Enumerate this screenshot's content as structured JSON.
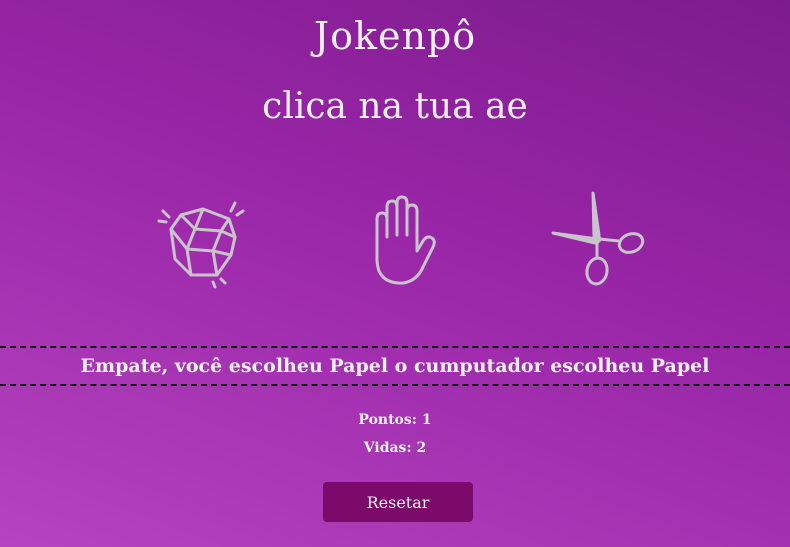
{
  "header": {
    "title": "Jokenpô",
    "instruction": "clica na tua ae"
  },
  "choices": [
    {
      "id": "rock",
      "icon": "rock-icon"
    },
    {
      "id": "paper",
      "icon": "hand-icon"
    },
    {
      "id": "scissors",
      "icon": "scissors-icon"
    }
  ],
  "result": {
    "message": "Empate, você escolheu Papel o cumputador escolheu Papel"
  },
  "stats": {
    "points_label": "Pontos: 1",
    "lives_label": "Vidas: 2"
  },
  "controls": {
    "reset_label": "Resetar"
  },
  "colors": {
    "background_top": "#7c1c8c",
    "background_bottom": "#b444c0",
    "icon_stroke": "#c8c4cc",
    "reset_button": "#7b0a6a",
    "divider": "#141018"
  }
}
